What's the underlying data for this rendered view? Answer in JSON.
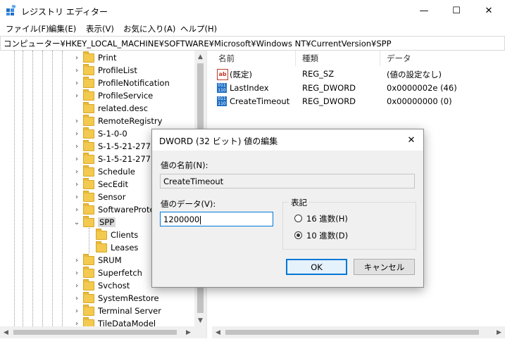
{
  "window": {
    "title": "レジストリ エディター",
    "controls": {
      "minimize": "—",
      "maximize": "☐",
      "close": "✕"
    }
  },
  "menu": [
    "ファイル(F)",
    "編集(E)",
    "表示(V)",
    "お気に入り(A)",
    "ヘルプ(H)"
  ],
  "address": "コンピューター¥HKEY_LOCAL_MACHINE¥SOFTWARE¥Microsoft¥Windows NT¥CurrentVersion¥SPP",
  "tree": {
    "items": [
      {
        "label": "Print",
        "expanded": false
      },
      {
        "label": "ProfileList",
        "expanded": false
      },
      {
        "label": "ProfileNotification",
        "expanded": false
      },
      {
        "label": "ProfileService",
        "expanded": false
      },
      {
        "label": "related.desc",
        "expanded": false
      },
      {
        "label": "RemoteRegistry",
        "expanded": false
      },
      {
        "label": "S-1-0-0",
        "expanded": false
      },
      {
        "label": "S-1-5-21-27772",
        "expanded": false
      },
      {
        "label": "S-1-5-21-27772",
        "expanded": false
      },
      {
        "label": "Schedule",
        "expanded": false
      },
      {
        "label": "SecEdit",
        "expanded": false
      },
      {
        "label": "Sensor",
        "expanded": false
      },
      {
        "label": "SoftwareProtec",
        "expanded": false
      },
      {
        "label": "SPP",
        "expanded": true,
        "selected": true
      },
      {
        "label": "Clients",
        "child": true
      },
      {
        "label": "Leases",
        "child": true
      },
      {
        "label": "SRUM",
        "expanded": false
      },
      {
        "label": "Superfetch",
        "expanded": false
      },
      {
        "label": "Svchost",
        "expanded": false
      },
      {
        "label": "SystemRestore",
        "expanded": false
      },
      {
        "label": "Terminal Server",
        "expanded": false
      },
      {
        "label": "TileDataModel",
        "expanded": false
      }
    ]
  },
  "list": {
    "columns": [
      "名前",
      "種類",
      "データ"
    ],
    "rows": [
      {
        "name": "(既定)",
        "type": "REG_SZ",
        "data": "(値の設定なし)",
        "icon": "string-value-icon"
      },
      {
        "name": "LastIndex",
        "type": "REG_DWORD",
        "data": "0x0000002e (46)",
        "icon": "binary-value-icon"
      },
      {
        "name": "CreateTimeout",
        "type": "REG_DWORD",
        "data": "0x00000000 (0)",
        "icon": "binary-value-icon"
      }
    ]
  },
  "dialog": {
    "title": "DWORD (32 ビット) 値の編集",
    "name_label": "値の名前(N):",
    "name_value": "CreateTimeout",
    "data_label": "値のデータ(V):",
    "data_value": "1200000",
    "radix_legend": "表記",
    "radix_hex": "16 進数(H)",
    "radix_dec": "10 進数(D)",
    "radix_selected": "dec",
    "ok": "OK",
    "cancel": "キャンセル"
  },
  "colors": {
    "accent": "#0078d7",
    "folder": "#f3c94f",
    "dialog_bg": "#f0f0f0"
  }
}
